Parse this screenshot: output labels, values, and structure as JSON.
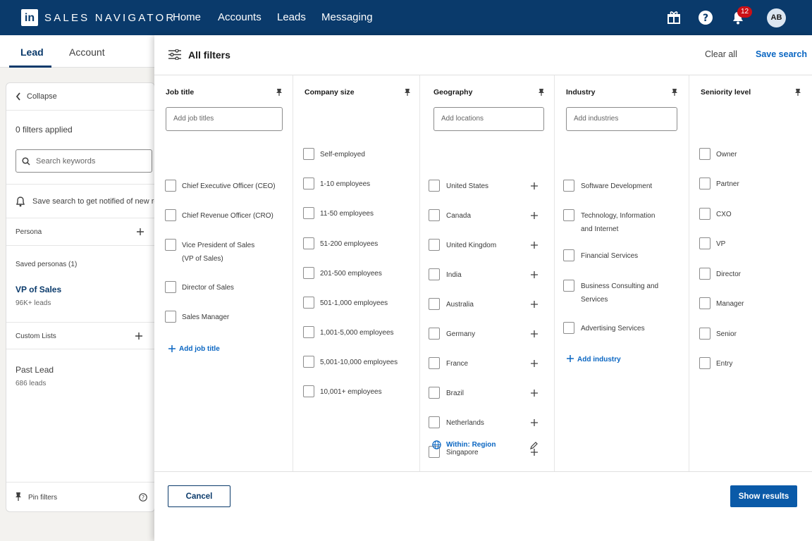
{
  "nav": {
    "logo": "in",
    "brand": "SALES NAVIGATOR",
    "links": [
      "Home",
      "Accounts",
      "Leads",
      "Messaging"
    ],
    "notifications_count": "12",
    "avatar_initials": "AB"
  },
  "tabs": [
    "Lead",
    "Account"
  ],
  "sidebar": {
    "collapse": "Collapse",
    "filters_applied": "0 filters applied",
    "search_placeholder": "Search keywords",
    "save_search_notice": "Save search to get notified of new results",
    "persona": "Persona",
    "saved_personas": "Saved personas (1)",
    "persona_name": "VP of Sales",
    "persona_count": "96K+ leads",
    "custom_lists": "Custom Lists",
    "list_name": "Past Lead",
    "list_count": "686 leads",
    "pin_filters": "Pin filters"
  },
  "panel": {
    "title": "All filters",
    "clear_all": "Clear all",
    "save_search": "Save search",
    "cancel": "Cancel",
    "show_results": "Show results"
  },
  "columns": {
    "job_title": {
      "title": "Job title",
      "placeholder": "Add job titles",
      "items": [
        "Chief Executive Officer (CEO)",
        "Chief Revenue Officer (CRO)",
        "Vice President of Sales",
        "(VP of Sales)",
        "Director of Sales",
        "Sales Manager"
      ],
      "add": "Add job title"
    },
    "company_size": {
      "title": "Company size",
      "items": [
        "Self-employed",
        "1-10 employees",
        "11-50 employees",
        "51-200 employees",
        "201-500 employees",
        "501-1,000 employees",
        "1,001-5,000 employees",
        "5,001-10,000 employees",
        "10,001+ employees"
      ]
    },
    "geography": {
      "title": "Geography",
      "placeholder": "Add locations",
      "items": [
        "United States",
        "Canada",
        "United Kingdom",
        "India",
        "Australia",
        "Germany",
        "France",
        "Brazil",
        "Netherlands",
        "Singapore"
      ],
      "within": "Within: Region"
    },
    "industry": {
      "title": "Industry",
      "placeholder": "Add industries",
      "items": [
        "Software Development",
        "Technology, Information",
        "and Internet",
        "Financial Services",
        "Business Consulting and",
        "Services",
        "Advertising Services"
      ],
      "add": "Add industry"
    },
    "seniority": {
      "title": "Seniority level",
      "items": [
        "Owner",
        "Partner",
        "CXO",
        "VP",
        "Director",
        "Manager",
        "Senior",
        "Entry"
      ]
    }
  },
  "colors": {
    "nav_bg": "#0a3a6b",
    "accent": "#0a66c2",
    "primary_button": "#0a5aa8",
    "badge": "#cc1016"
  }
}
